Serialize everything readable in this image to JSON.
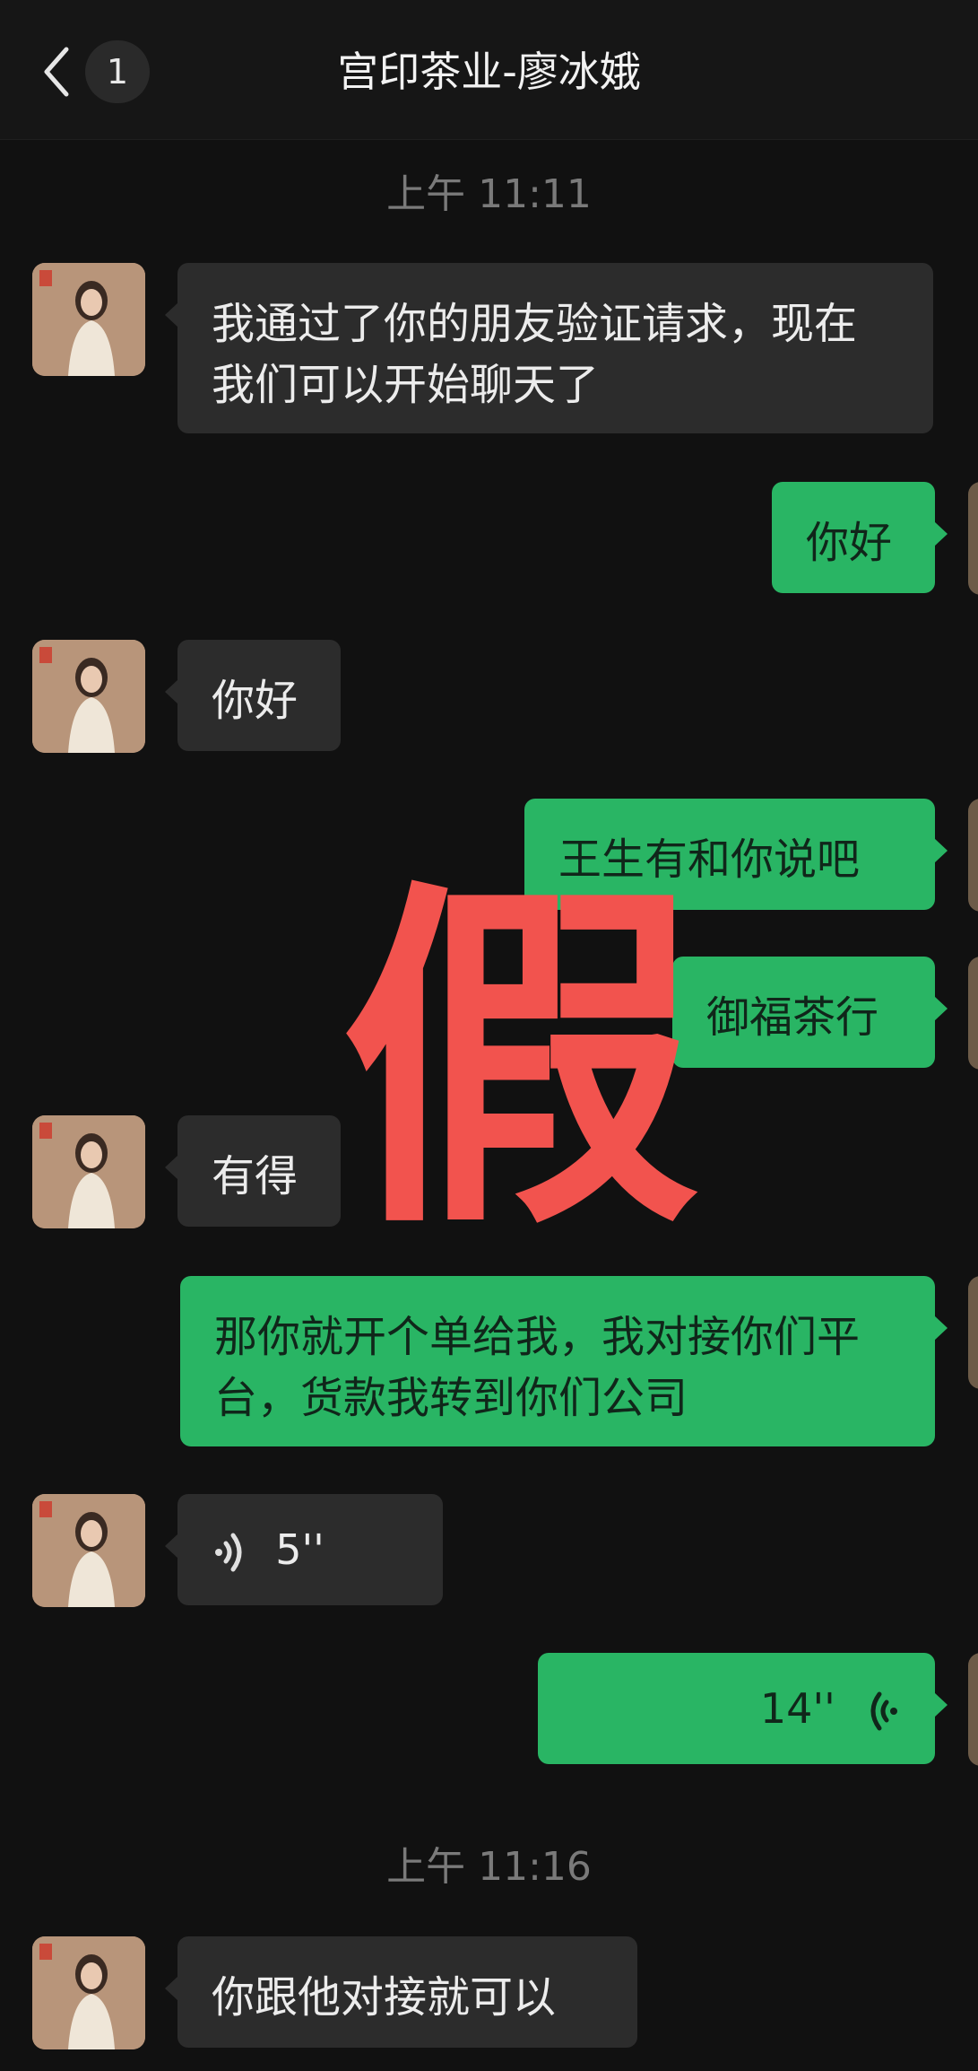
{
  "header": {
    "unread_count": "1",
    "title": "宫印茶业-廖冰娥"
  },
  "timestamps": [
    "上午 11:11",
    "上午 11:16"
  ],
  "messages": [
    {
      "side": "in",
      "text": "我通过了你的朋友验证请求，现在我们可以开始聊天了"
    },
    {
      "side": "out",
      "text": "你好"
    },
    {
      "side": "in",
      "text": "你好"
    },
    {
      "side": "out",
      "text": "王生有和你说吧"
    },
    {
      "side": "out",
      "text": "御福茶行"
    },
    {
      "side": "in",
      "text": "有得"
    },
    {
      "side": "out",
      "text": "那你就开个单给我，我对接你们平台，货款我转到你们公司"
    },
    {
      "side": "in",
      "type": "voice",
      "duration": "5''"
    },
    {
      "side": "out",
      "type": "voice",
      "duration": "14''"
    },
    {
      "side": "in",
      "text": "你跟他对接就可以"
    }
  ],
  "watermark": "假",
  "colors": {
    "background": "#111111",
    "incoming_bubble": "#2c2c2c",
    "outgoing_bubble": "#29b564",
    "watermark": "#f2534e"
  }
}
